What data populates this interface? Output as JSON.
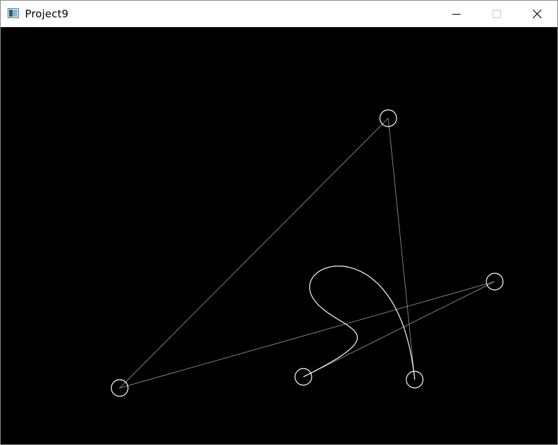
{
  "window": {
    "title": "Project9",
    "icon": "application-window-icon"
  },
  "titlebar": {
    "minimize_icon": "minimize-icon",
    "maximize_icon": "maximize-icon",
    "close_icon": "close-icon"
  },
  "canvas": {
    "background_color": "#000000",
    "control_polygon_color": "#808080",
    "curve_color": "#ffffff",
    "control_point_color": "#ffffff"
  }
}
